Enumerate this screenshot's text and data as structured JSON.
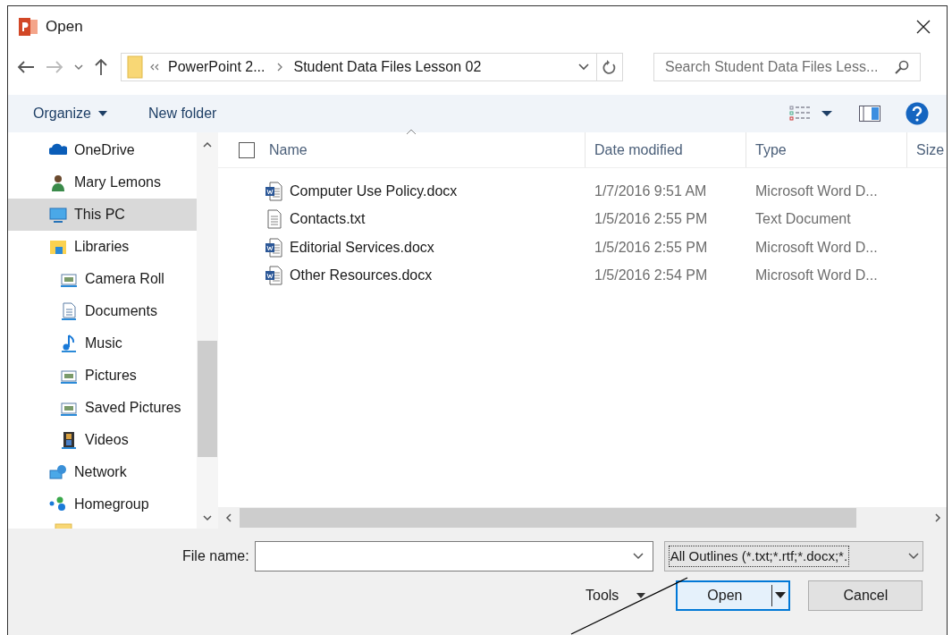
{
  "window": {
    "title": "Open"
  },
  "address": {
    "parent": "PowerPoint 2...",
    "current": "Student Data Files Lesson 02"
  },
  "search": {
    "placeholder": "Search Student Data Files Less..."
  },
  "toolbar": {
    "organize": "Organize",
    "new_folder": "New folder"
  },
  "sidebar": {
    "items": [
      {
        "label": "OneDrive",
        "kind": "cloud",
        "selected": false
      },
      {
        "label": "Mary Lemons",
        "kind": "user",
        "selected": false
      },
      {
        "label": "This PC",
        "kind": "pc",
        "selected": true
      },
      {
        "label": "Libraries",
        "kind": "library",
        "selected": false,
        "children": [
          {
            "label": "Camera Roll",
            "kind": "picture",
            "selected": false
          },
          {
            "label": "Documents",
            "kind": "document",
            "selected": false
          },
          {
            "label": "Music",
            "kind": "music",
            "selected": false
          },
          {
            "label": "Pictures",
            "kind": "picture",
            "selected": false
          },
          {
            "label": "Saved Pictures",
            "kind": "picture",
            "selected": false
          },
          {
            "label": "Videos",
            "kind": "video",
            "selected": false
          }
        ]
      },
      {
        "label": "Network",
        "kind": "network",
        "selected": false
      },
      {
        "label": "Homegroup",
        "kind": "homegroup",
        "selected": false
      }
    ]
  },
  "table": {
    "select_all_checked": false,
    "columns": [
      "Name",
      "Date modified",
      "Type",
      "Size"
    ],
    "rows": [
      {
        "name": "Computer Use Policy.docx",
        "date": "1/7/2016 9:51 AM",
        "type": "Microsoft Word D...",
        "kind": "word"
      },
      {
        "name": "Contacts.txt",
        "date": "1/5/2016 2:55 PM",
        "type": "Text Document",
        "kind": "text"
      },
      {
        "name": "Editorial Services.docx",
        "date": "1/5/2016 2:55 PM",
        "type": "Microsoft Word D...",
        "kind": "word"
      },
      {
        "name": "Other Resources.docx",
        "date": "1/5/2016 2:54 PM",
        "type": "Microsoft Word D...",
        "kind": "word"
      }
    ]
  },
  "file_name": {
    "label": "File name:"
  },
  "file_type": {
    "value": "All Outlines (*.txt;*.rtf;*.docx;*."
  },
  "buttons": {
    "tools": "Tools",
    "open": "Open",
    "cancel": "Cancel"
  }
}
